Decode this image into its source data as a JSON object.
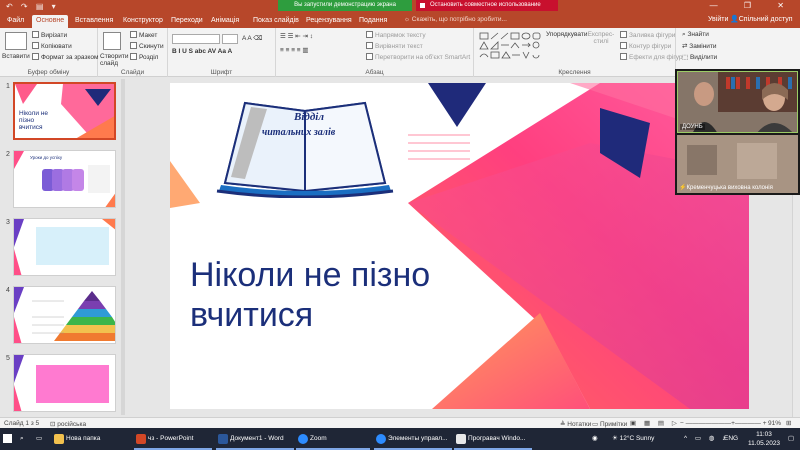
{
  "app": {
    "quick_access": "↶ ↷ ▤ ▾"
  },
  "share": {
    "banner": "Вы запустили демонстрацию экрана",
    "stop": "Остановить совместное использование"
  },
  "window": {
    "controls": "— ❐ ✕"
  },
  "tabs": [
    {
      "label": "Файл"
    },
    {
      "label": "Основне"
    },
    {
      "label": "Вставлення"
    },
    {
      "label": "Конструктор"
    },
    {
      "label": "Переходи"
    },
    {
      "label": "Анімація"
    },
    {
      "label": "Показ слайдів"
    },
    {
      "label": "Рецензування"
    },
    {
      "label": "Подання"
    }
  ],
  "tell_me": "Скажіть, що потрібно зробити...",
  "user": {
    "signin": "Увійти",
    "share": "Спільний доступ"
  },
  "ribbon": {
    "clipboard": {
      "label": "Буфер обміну",
      "paste": "Вставити",
      "cut": "Вирізати",
      "copy": "Копіювати",
      "format": "Формат за зразком"
    },
    "slides": {
      "label": "Слайди",
      "new": "Створити слайд",
      "layout": "Макет",
      "reset": "Скинути",
      "section": "Розділ"
    },
    "font": {
      "label": "Шрифт"
    },
    "paragraph": {
      "label": "Абзац",
      "direction": "Напрямок тексту",
      "align": "Вирівняти текст",
      "smartart": "Перетворити на об'єкт SmartArt"
    },
    "drawing": {
      "label": "Креслення",
      "arrange": "Упорядкувати",
      "styles": "Експрес-стилі",
      "fill": "Заливка фігури",
      "outline": "Контур фігури",
      "effects": "Ефекти для фігур"
    },
    "editing": {
      "find": "Знайти",
      "replace": "Замінити",
      "select": "Виділити"
    }
  },
  "slides": [
    {
      "num": "1"
    },
    {
      "num": "2"
    },
    {
      "num": "3"
    },
    {
      "num": "4"
    },
    {
      "num": "5"
    }
  ],
  "thumb": {
    "s1_title": "Ніколи не пізно вчитися",
    "s2_title": "Уроки до успіху"
  },
  "slide": {
    "logo_line1": "Відділ",
    "logo_line2": "читальних залів",
    "title": "Ніколи не пізно вчитися"
  },
  "zoom": {
    "participant1": "ДОУНБ",
    "participant2": "Кременчуцька виховна колонія"
  },
  "status": {
    "slide_info": "Слайд 1 з 5",
    "language": "російська",
    "notes": "Нотатки",
    "comments": "Примітки",
    "zoom": "91%"
  },
  "taskbar": [
    {
      "label": "Нова папка",
      "color": "#f2c14e"
    },
    {
      "label": "чз - PowerPoint",
      "color": "#d24726"
    },
    {
      "label": "Документ1 - Word",
      "color": "#2b579a"
    },
    {
      "label": "Zoom",
      "color": "#2d8cff"
    },
    {
      "label": "Элементы управл...",
      "color": "#2d8cff"
    },
    {
      "label": "Програвач Windo...",
      "color": "#e8e8e8"
    }
  ],
  "tray": {
    "weather": "12°C  Sunny",
    "lang": "ENG",
    "time": "11:03",
    "date": "11.05.2023"
  },
  "colors": {
    "accent": "#b7472a",
    "slide_title": "#1b2f7a",
    "navy": "#1f3a8a",
    "pink": "#ff4f88",
    "orange": "#ff7a4d"
  }
}
